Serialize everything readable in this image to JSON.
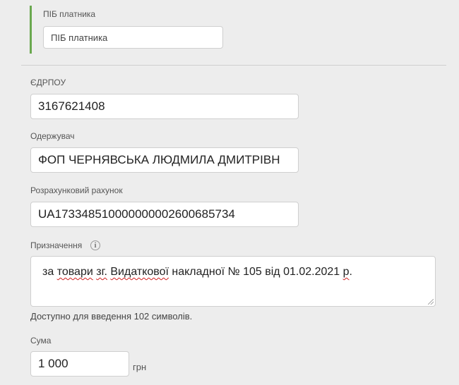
{
  "payer": {
    "label": "ПІБ платника",
    "placeholder": "ПІБ платника",
    "value": ""
  },
  "edrpou": {
    "label": "ЄДРПОУ",
    "value": "3167621408"
  },
  "recipient": {
    "label": "Одержувач",
    "value": "ФОП ЧЕРНЯВСЬКА ЛЮДМИЛА ДМИТРІВН"
  },
  "account": {
    "label": "Розрахунковий рахунок",
    "value": "UA173348510000000002600685734"
  },
  "purpose": {
    "label": "Призначення",
    "info_icon": "info-icon",
    "parts": [
      "за ",
      "товари",
      " ",
      "зг.",
      " ",
      "Видаткової",
      " накладної № 105 від 01.02.2021 ",
      "р",
      "."
    ],
    "chars_left_text": "Доступно для введення 102 символів."
  },
  "amount": {
    "label": "Сума",
    "value": "1 000",
    "currency": "грн"
  },
  "colors": {
    "accent_bar": "#6aa84f",
    "spellcheck": "#d02020"
  }
}
